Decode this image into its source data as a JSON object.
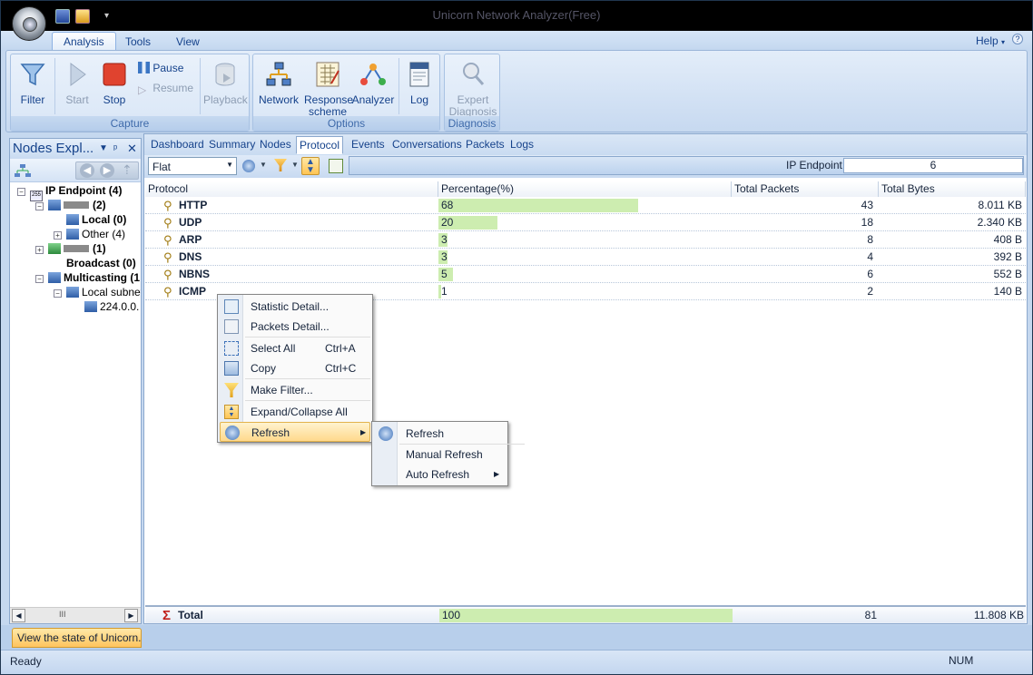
{
  "window": {
    "title": "Unicorn Network Analyzer(Free)"
  },
  "ribbon": {
    "tabs": [
      "Analysis",
      "Tools",
      "View"
    ],
    "help_label": "Help",
    "groups": {
      "capture": {
        "label": "Capture",
        "filter": "Filter",
        "start": "Start",
        "stop": "Stop",
        "pause": "Pause",
        "resume": "Resume",
        "playback": "Playback"
      },
      "options": {
        "label": "Options",
        "network": "Network",
        "response_scheme_1": "Response",
        "response_scheme_2": "scheme",
        "analyzer": "Analyzer",
        "log": "Log"
      },
      "diagnosis": {
        "label": "Diagnosis",
        "expert_1": "Expert",
        "expert_2": "Diagnosis"
      }
    }
  },
  "nodes_explorer": {
    "title": "Nodes Expl...",
    "tree": {
      "ip_endpoint": "IP Endpoint (4)",
      "node_a": "(2)",
      "local": "Local (0)",
      "other": "Other (4)",
      "node_b": "(1)",
      "broadcast": "Broadcast (0)",
      "multicasting": "Multicasting (1",
      "local_subnet": "Local subnet",
      "addr": "224.0.0."
    }
  },
  "view_tabs": [
    "Dashboard",
    "Summary",
    "Nodes",
    "Protocol",
    "Events",
    "Conversations",
    "Packets",
    "Logs"
  ],
  "active_view_tab": "Protocol",
  "toolbar": {
    "mode_select": "Flat",
    "ip_endpoint_label": "IP Endpoint",
    "ip_endpoint_value": "6"
  },
  "table": {
    "columns": [
      "Protocol",
      "Percentage(%)",
      "Total Packets",
      "Total Bytes"
    ],
    "rows": [
      {
        "protocol": "HTTP",
        "percent": "68",
        "packets": "43",
        "bytes": "8.011 KB"
      },
      {
        "protocol": "UDP",
        "percent": "20",
        "packets": "18",
        "bytes": "2.340 KB"
      },
      {
        "protocol": "ARP",
        "percent": "3",
        "packets": "8",
        "bytes": "408 B"
      },
      {
        "protocol": "DNS",
        "percent": "3",
        "packets": "4",
        "bytes": "392 B"
      },
      {
        "protocol": "NBNS",
        "percent": "5",
        "packets": "6",
        "bytes": "552 B"
      },
      {
        "protocol": "ICMP",
        "percent": "1",
        "packets": "2",
        "bytes": "140 B"
      }
    ],
    "total": {
      "label": "Total",
      "percent": "100",
      "packets": "81",
      "bytes": "11.808 KB"
    }
  },
  "context_menu": {
    "statistic_detail": "Statistic Detail...",
    "packets_detail": "Packets Detail...",
    "select_all": "Select All",
    "select_all_sc": "Ctrl+A",
    "copy": "Copy",
    "copy_sc": "Ctrl+C",
    "make_filter": "Make Filter...",
    "expand_collapse": "Expand/Collapse All",
    "refresh": "Refresh"
  },
  "submenu": {
    "refresh": "Refresh",
    "manual_refresh": "Manual Refresh",
    "auto_refresh": "Auto Refresh"
  },
  "status": {
    "hint": "View the state of Unicorn.",
    "ready": "Ready",
    "num": "NUM"
  },
  "colors": {
    "bar": "#cdedb0",
    "accent": "#15428b",
    "highlight": "#ffd98c"
  }
}
